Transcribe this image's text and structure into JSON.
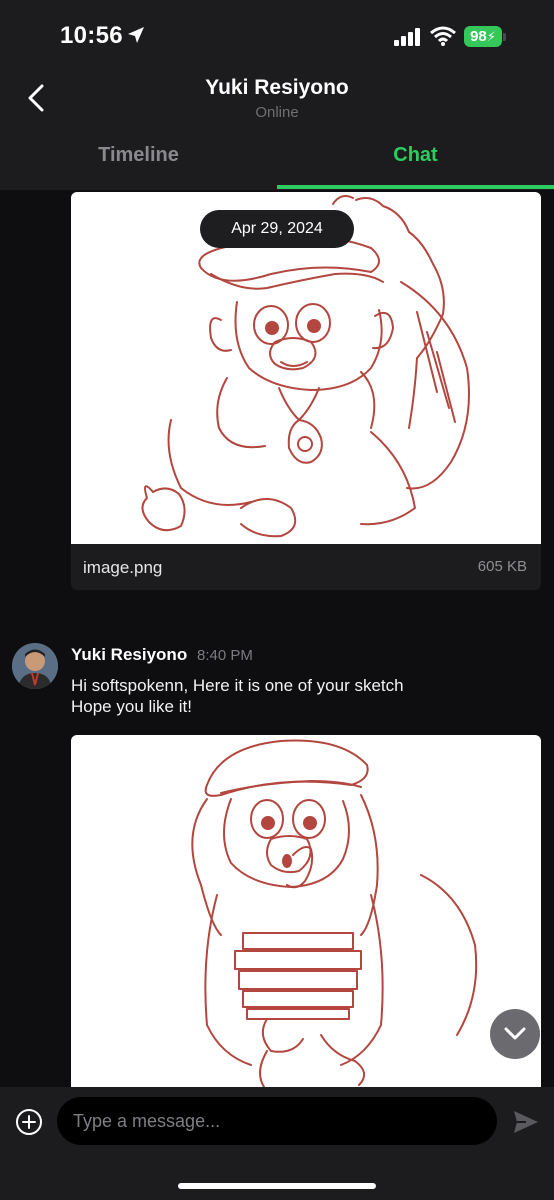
{
  "status_bar": {
    "time": "10:56",
    "battery": "98"
  },
  "header": {
    "contact_name": "Yuki Resiyono",
    "contact_status": "Online"
  },
  "tabs": [
    {
      "label": "Timeline",
      "active": false
    },
    {
      "label": "Chat",
      "active": true
    }
  ],
  "date_separator": "Apr 29, 2024",
  "attachment": {
    "file_name": "image.png",
    "file_size": "605 KB"
  },
  "message": {
    "sender": "Yuki Resiyono",
    "time": "8:40 PM",
    "lines": [
      "Hi softspokenn, Here it is one of your sketch",
      "Hope you like it!"
    ]
  },
  "composer": {
    "placeholder": "Type a message..."
  },
  "colors": {
    "accent": "#2ecc5f",
    "battery": "#34c759",
    "background": "#0e0e10",
    "surface": "#1c1c1e",
    "sketch": "#b3473f"
  },
  "icons": [
    "location-arrow-icon",
    "signal-icon",
    "wifi-icon",
    "back-chevron-icon",
    "chevron-down-icon",
    "plus-circle-icon",
    "send-icon"
  ]
}
